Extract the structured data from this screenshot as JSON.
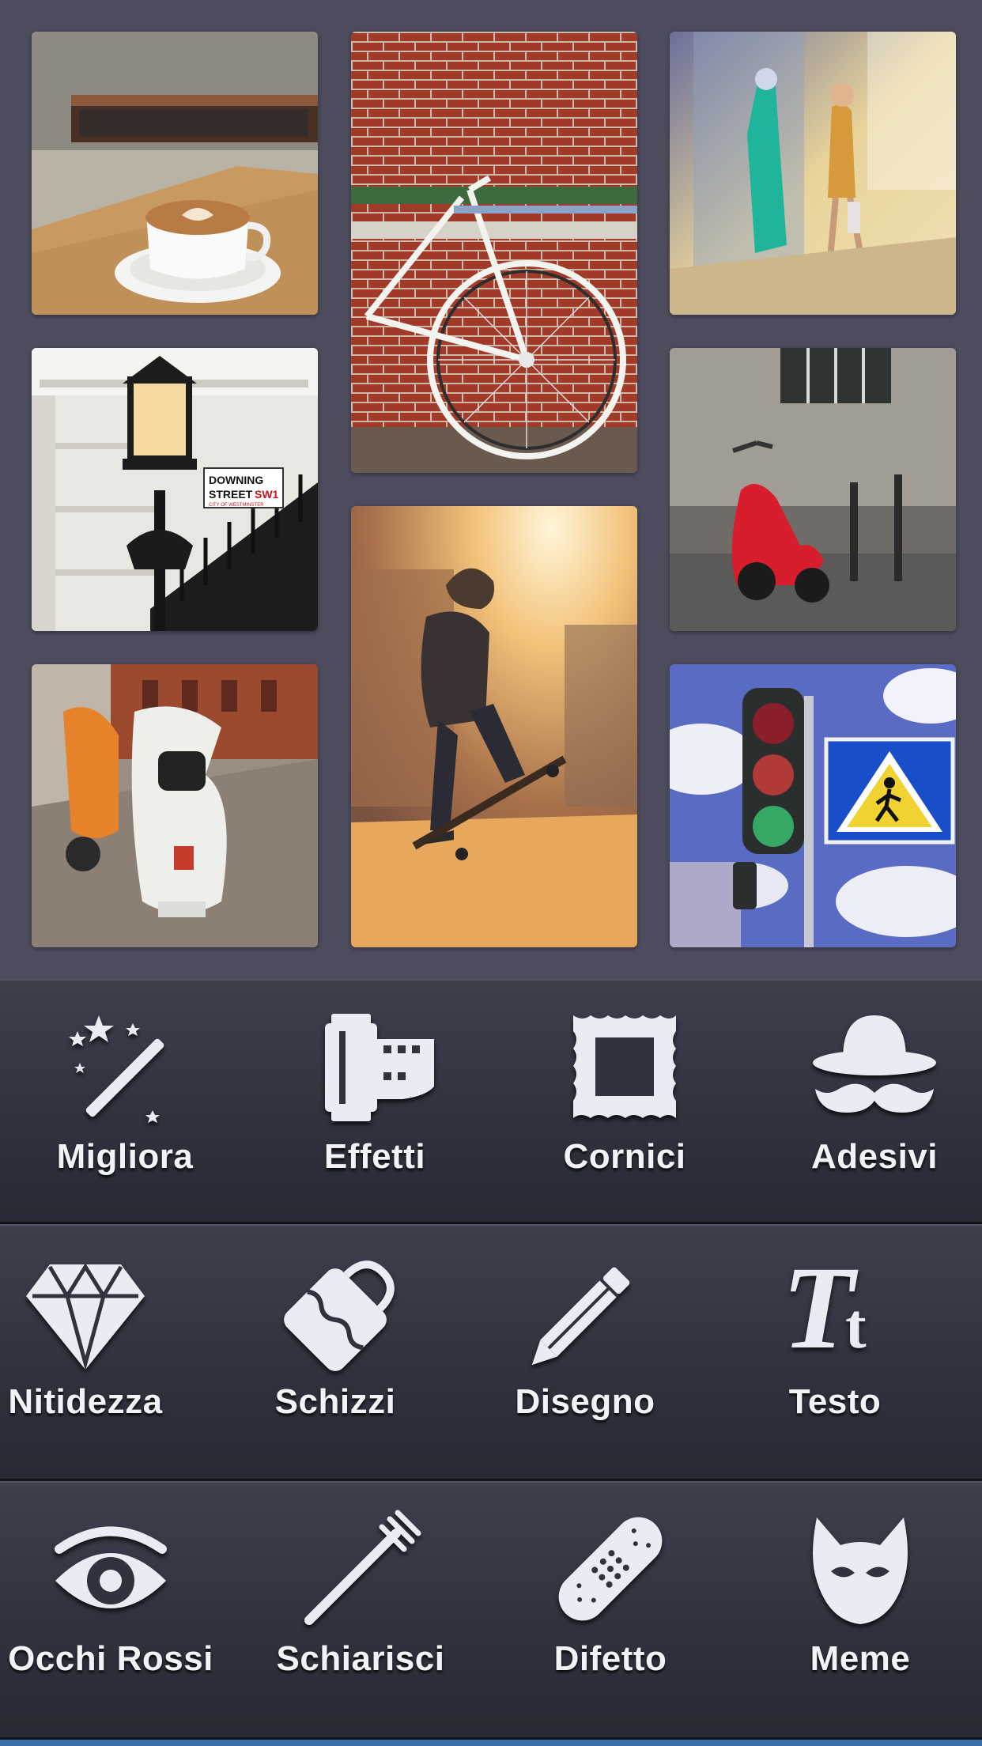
{
  "photos": [
    {
      "name": "photo-coffee-cup",
      "kind": "coffee"
    },
    {
      "name": "photo-bicycle-brick-wall",
      "kind": "bicycle"
    },
    {
      "name": "photo-shop-window",
      "kind": "shop"
    },
    {
      "name": "photo-street-lamp",
      "kind": "lamp"
    },
    {
      "name": "photo-red-scooter",
      "kind": "redscooter"
    },
    {
      "name": "photo-skateboarder",
      "kind": "skate"
    },
    {
      "name": "photo-vintage-scooters",
      "kind": "scooters"
    },
    {
      "name": "photo-traffic-light",
      "kind": "traffic"
    }
  ],
  "street_sign": {
    "line1": "DOWNING",
    "line2": "STREET",
    "code": "SW1",
    "sub": "CITY OF WESTMINSTER"
  },
  "toolbar": {
    "rows": [
      [
        {
          "label": "Migliora",
          "icon": "magic-wand-icon"
        },
        {
          "label": "Effetti",
          "icon": "film-roll-icon"
        },
        {
          "label": "Cornici",
          "icon": "frame-icon"
        },
        {
          "label": "Adesivi",
          "icon": "hat-mustache-icon"
        }
      ],
      [
        {
          "label": "Nitidezza",
          "icon": "diamond-icon"
        },
        {
          "label": "Schizzi",
          "icon": "paint-bucket-icon"
        },
        {
          "label": "Disegno",
          "icon": "pencil-icon"
        },
        {
          "label": "Testo",
          "icon": "text-icon"
        }
      ],
      [
        {
          "label": "Occhi Rossi",
          "icon": "eye-icon"
        },
        {
          "label": "Schiarisci",
          "icon": "toothbrush-icon"
        },
        {
          "label": "Difetto",
          "icon": "bandage-icon"
        },
        {
          "label": "Meme",
          "icon": "cat-mask-icon"
        }
      ]
    ],
    "icon_color": "#e9ecf3",
    "accent_strip": "#3b6fa8"
  },
  "text_icon_glyph": {
    "big": "T",
    "small": "t"
  }
}
